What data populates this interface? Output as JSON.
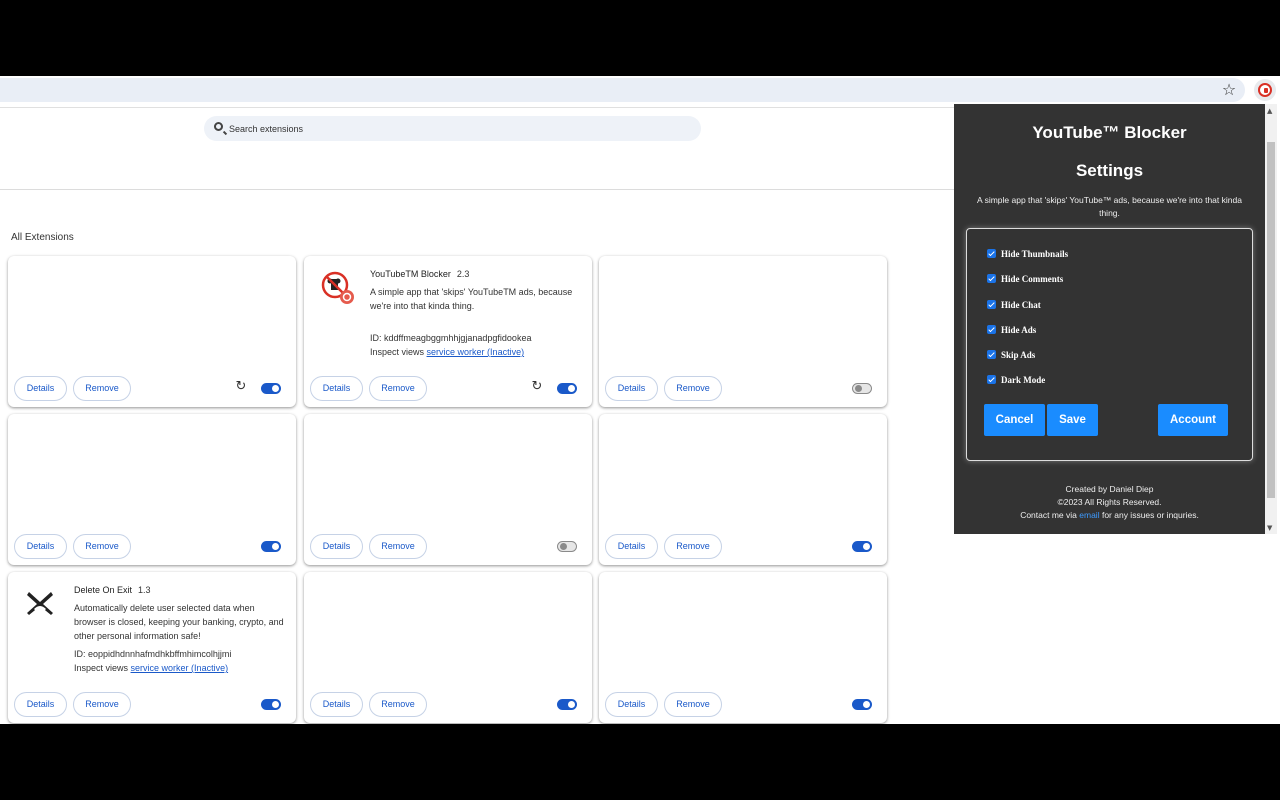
{
  "toolbar": {
    "star_icon": "star-icon",
    "extension_icon": "youtube-blocker-icon"
  },
  "search": {
    "placeholder": "Search extensions"
  },
  "section_title": "All Extensions",
  "cards": [
    {
      "details": "Details",
      "remove": "Remove",
      "enabled": true,
      "reload": true
    },
    {
      "name": "YouTubeTM Blocker",
      "version": "2.3",
      "description": "A simple app that 'skips' YouTubeTM ads, because we're into that kinda thing.",
      "id": "ID: kddffmeagbggmhhjgjanadpgfidookea",
      "inspect_label": "Inspect views",
      "inspect_link": "service worker (Inactive)",
      "details": "Details",
      "remove": "Remove",
      "enabled": true,
      "reload": true
    },
    {
      "details": "Details",
      "remove": "Remove",
      "enabled": false
    },
    {
      "details": "Details",
      "remove": "Remove",
      "enabled": true
    },
    {
      "details": "Details",
      "remove": "Remove",
      "enabled": false
    },
    {
      "details": "Details",
      "remove": "Remove",
      "enabled": true
    },
    {
      "name": "Delete On Exit",
      "version": "1.3",
      "description": "Automatically delete user selected data when browser is closed, keeping your banking, crypto, and other personal information safe!",
      "id": "ID: eoppidhdnnhafmdhkbffmhimcolhjjmi",
      "inspect_label": "Inspect views",
      "inspect_link": "service worker (Inactive)",
      "details": "Details",
      "remove": "Remove",
      "enabled": true
    },
    {
      "details": "Details",
      "remove": "Remove",
      "enabled": true
    },
    {
      "details": "Details",
      "remove": "Remove",
      "enabled": true
    }
  ],
  "popup": {
    "title": "YouTube™ Blocker",
    "subtitle": "Settings",
    "description": "A simple app that 'skips' YouTube™ ads, because we're into that kinda thing.",
    "options": [
      {
        "label": "Hide Thumbnails",
        "checked": true
      },
      {
        "label": "Hide Comments",
        "checked": true
      },
      {
        "label": "Hide Chat",
        "checked": true
      },
      {
        "label": "Hide Ads",
        "checked": true
      },
      {
        "label": "Skip Ads",
        "checked": true
      },
      {
        "label": "Dark Mode",
        "checked": true
      }
    ],
    "cancel": "Cancel",
    "save": "Save",
    "account": "Account",
    "footer_created": "Created by Daniel Diep",
    "footer_copyright": "©2023 All Rights Reserved.",
    "footer_contact_pre": "Contact me via",
    "footer_contact_link": "email",
    "footer_contact_post": "for any issues or inquries."
  },
  "colors": {
    "accent": "#1a59c9",
    "popup_bg": "#333333",
    "popup_button": "#1a8cff"
  }
}
